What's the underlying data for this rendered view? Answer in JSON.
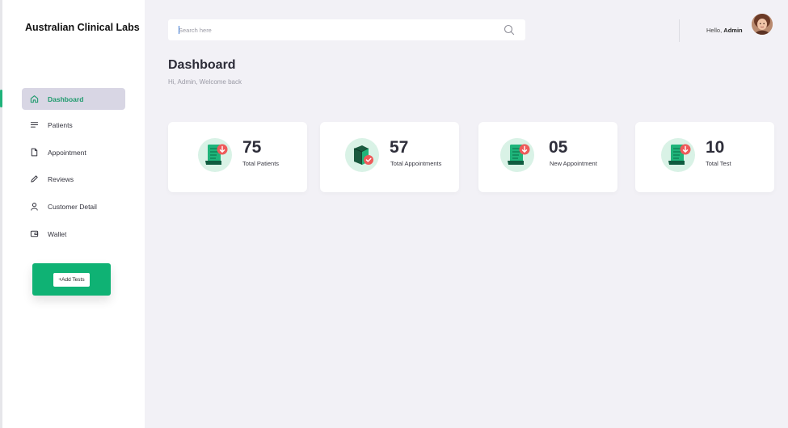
{
  "app": {
    "brand": "Australian Clinical Labs"
  },
  "sidebar": {
    "items": [
      {
        "label": "Dashboard",
        "icon": "home-icon",
        "active": true
      },
      {
        "label": "Patients",
        "icon": "list-icon"
      },
      {
        "label": "Appointment",
        "icon": "file-icon"
      },
      {
        "label": "Reviews",
        "icon": "pencil-icon"
      },
      {
        "label": "Customer Detail",
        "icon": "user-icon"
      },
      {
        "label": "Wallet",
        "icon": "wallet-icon"
      }
    ],
    "add_tests_label": "+Add Tests"
  },
  "header": {
    "search_placeholder": "Search here",
    "greeting_prefix": "Hello,",
    "greeting_name": "Admin"
  },
  "main": {
    "title": "Dashboard",
    "subtitle": "Hi, Admin, Welcome back"
  },
  "stats": [
    {
      "value": "75",
      "label": "Total Patients",
      "icon": "receipt-download-icon"
    },
    {
      "value": "57",
      "label": "Total Appointments",
      "icon": "box-check-icon"
    },
    {
      "value": "05",
      "label": "New Appointment",
      "icon": "receipt-download-icon"
    },
    {
      "value": "10",
      "label": "Total Test",
      "icon": "receipt-download-icon"
    }
  ],
  "colors": {
    "accent_green": "#0fb274",
    "active_nav_bg": "#d8d6e4",
    "active_nav_text": "#1f9a6d",
    "badge_red": "#ee5a5a",
    "icon_circle": "#d9f2e6",
    "background": "#f2f1f6"
  }
}
